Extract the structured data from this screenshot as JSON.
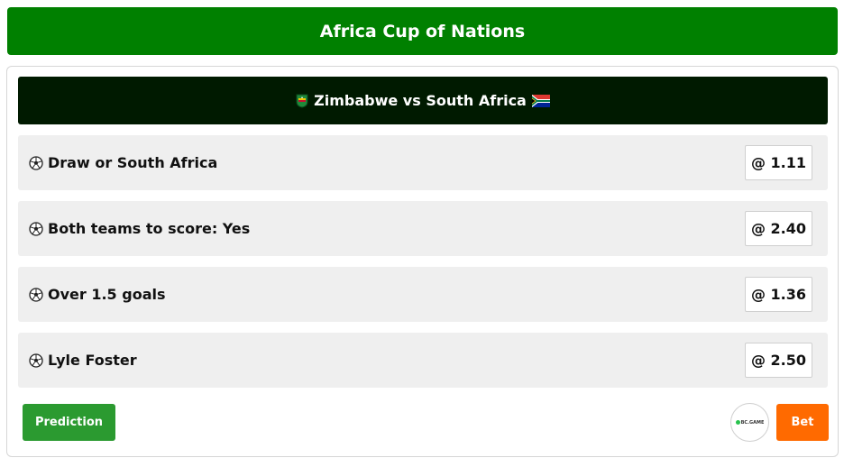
{
  "header": {
    "title": "Africa Cup of Nations"
  },
  "match": {
    "title": "Zimbabwe vs South Africa",
    "home_flag_icon": "zimbabwe-flag-icon",
    "away_flag_icon": "south-africa-flag-icon"
  },
  "tips": [
    {
      "label": "Draw or South Africa",
      "odds": "@ 1.11",
      "icon": "soccer-ball-icon"
    },
    {
      "label": "Both teams to score: Yes",
      "odds": "@ 2.40",
      "icon": "soccer-ball-icon"
    },
    {
      "label": "Over 1.5 goals",
      "odds": "@ 1.36",
      "icon": "soccer-ball-icon"
    },
    {
      "label": "Lyle Foster",
      "odds": "@ 2.50",
      "icon": "soccer-ball-icon"
    }
  ],
  "actions": {
    "prediction_label": "Prediction",
    "bookmaker_logo_text": "BC.GAME",
    "bet_label": "Bet"
  },
  "colors": {
    "header_bg": "#008000",
    "match_bar_bg": "#001a00",
    "prediction_btn": "#2b9a30",
    "bet_btn": "#ff6a00"
  }
}
